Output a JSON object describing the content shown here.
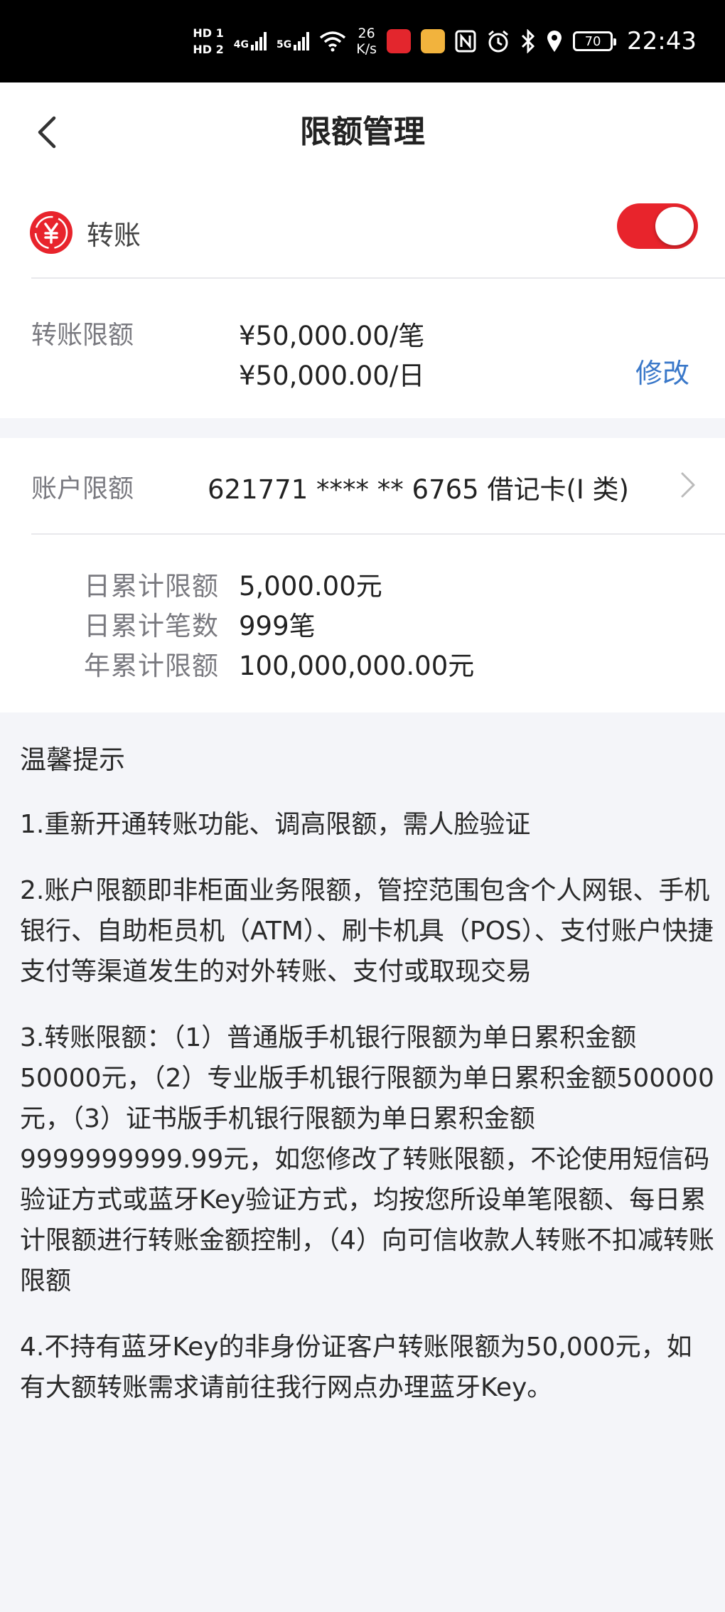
{
  "status_bar": {
    "hd1": "HD 1",
    "hd2": "HD 2",
    "net1": "4G",
    "net2": "5G",
    "speed_value": "26",
    "speed_unit": "K/s",
    "battery": "70",
    "time": "22:43"
  },
  "nav": {
    "title": "限额管理"
  },
  "transfer": {
    "label": "转账",
    "toggle_on": true,
    "limit_label": "转账限额",
    "per_transaction": "¥50,000.00/笔",
    "per_day": "¥50,000.00/日",
    "modify_label": "修改"
  },
  "account": {
    "label": "账户限额",
    "card": "621771 **** ** 6765 借记卡(I 类)",
    "stats": [
      {
        "label": "日累计限额",
        "value": "5,000.00元"
      },
      {
        "label": "日累计笔数",
        "value": "999笔"
      },
      {
        "label": "年累计限额",
        "value": "100,000,000.00元"
      }
    ]
  },
  "tips": {
    "title": "温馨提示",
    "items": [
      "1.重新开通转账功能、调高限额，需人脸验证",
      "2.账户限额即非柜面业务限额，管控范围包含个人网银、手机银行、自助柜员机（ATM）、刷卡机具（POS）、支付账户快捷支付等渠道发生的对外转账、支付或取现交易",
      "3.转账限额：（1）普通版手机银行限额为单日累积金额50000元，（2）专业版手机银行限额为单日累积金额500000元，（3）证书版手机银行限额为单日累积金额9999999999.99元，如您修改了转账限额，不论使用短信码验证方式或蓝牙Key验证方式，均按您所设单笔限额、每日累计限额进行转账金额控制，（4）向可信收款人转账不扣减转账限额",
      "4.不持有蓝牙Key的非身份证客户转账限额为50,000元，如有大额转账需求请前往我行网点办理蓝牙Key。"
    ]
  },
  "colors": {
    "accent_red": "#e8242c",
    "link_blue": "#3a78c9"
  },
  "icons": [
    "back-icon",
    "yen-transfer-icon",
    "chevron-right-icon"
  ]
}
